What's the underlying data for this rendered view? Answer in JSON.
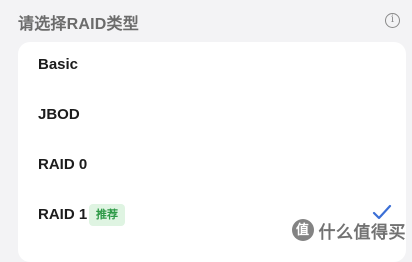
{
  "header": {
    "title": "请选择RAID类型",
    "info_icon": "info-icon"
  },
  "options": [
    {
      "label": "Basic",
      "selected": false
    },
    {
      "label": "JBOD",
      "selected": false
    },
    {
      "label": "RAID 0",
      "selected": false
    },
    {
      "label": "RAID 1",
      "badge": "推荐",
      "selected": true
    }
  ],
  "watermark": {
    "icon_text": "值",
    "text": "什么值得买"
  },
  "colors": {
    "background": "#f3f3f5",
    "badge_bg": "#dff4e2",
    "badge_text": "#2e9a47",
    "check": "#3b6fd6"
  }
}
